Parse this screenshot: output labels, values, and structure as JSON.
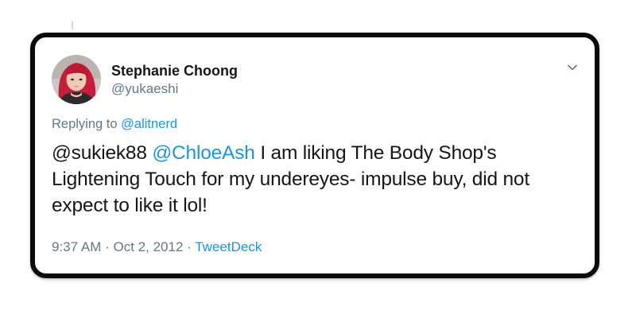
{
  "tweet": {
    "author": {
      "display_name": "Stephanie Choong",
      "handle": "@yukaeshi",
      "avatar_icon": "profile-photo-avatar"
    },
    "replying_prefix": "Replying to",
    "replying_to": "@alitnerd",
    "body": {
      "mention_1": "@sukiek88",
      "mention_2": "@ChloeAsh",
      "line_1_rest": "I am liking The Body Shop's",
      "line_2": "Lightening Touch for my undereyes- impulse buy, did not",
      "line_3": "expect to like it lol!"
    },
    "meta": {
      "time": "9:37 AM",
      "separator": "·",
      "date": "Oct 2, 2012",
      "source": "TweetDeck"
    },
    "menu_icon": "chevron-down-icon"
  },
  "colors": {
    "link": "#1b95e0",
    "secondary_text": "#657786",
    "primary_text": "#14171a",
    "card_border": "#0b0b0b"
  }
}
